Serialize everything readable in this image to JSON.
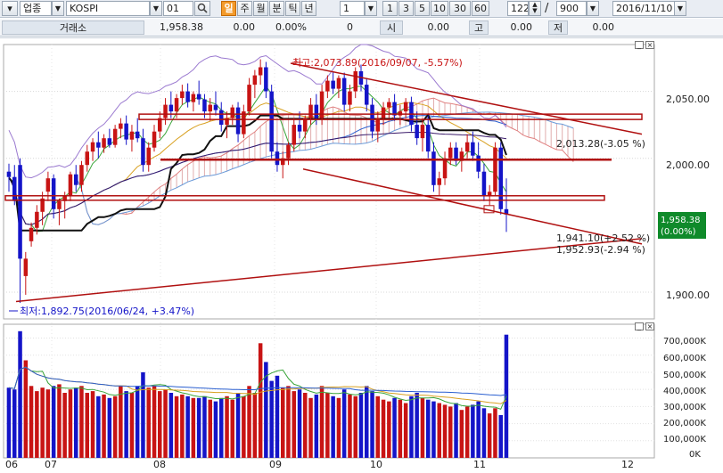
{
  "toolbar": {
    "market": "업종",
    "index": "KOSPI",
    "code": "01",
    "periods": [
      "일",
      "주",
      "월",
      "분",
      "틱",
      "년"
    ],
    "interval": "1",
    "minutes": [
      "1",
      "3",
      "5",
      "10",
      "30",
      "60"
    ],
    "count": "122",
    "total": "900",
    "date": "2016/11/10"
  },
  "info": {
    "label": "거래소",
    "price": "1,958.38",
    "change": "0.00",
    "rate": "0.00%",
    "volume": "0",
    "open_label": "시",
    "open": "0.00",
    "high_label": "고",
    "high": "0.00",
    "low_label": "저",
    "low": "0.00"
  },
  "price_axis": [
    "2,050.00",
    "2,000.00",
    "1,900.00"
  ],
  "volume_axis": [
    "700,000K",
    "600,000K",
    "500,000K",
    "400,000K",
    "300,000K",
    "200,000K",
    "100,000K",
    "0K"
  ],
  "months": [
    "06",
    "07",
    "08",
    "09",
    "10",
    "11",
    "12"
  ],
  "annotations": {
    "high": "최고:2,073.89(2016/09/07, -5.57%)",
    "low": "최저:1,892.75(2016/06/24, +3.47%)",
    "line1": "2,013.28(-3.05 %)",
    "line2": "1,941.10(+2.52 %)",
    "line3": "1,952.93(-2.94 %)"
  },
  "current_price": "1,958.38",
  "current_rate": "(0.00%)",
  "colors": {
    "up": "#c81414",
    "down": "#1414c8",
    "line": "#b01010",
    "ichimoku_cloud": "#d99a9a"
  },
  "chart_data": {
    "type": "candlestick",
    "ylim": [
      1880,
      2085
    ],
    "volume_ylim": [
      0,
      760
    ],
    "volume_unit": "K",
    "dates_range": [
      "2016/06",
      "2016/11/10"
    ],
    "months": [
      "06",
      "07",
      "08",
      "09",
      "10",
      "11",
      "12"
    ],
    "candles": [
      {
        "o": 1990,
        "h": 1996,
        "l": 1975,
        "c": 1986,
        "v": 410
      },
      {
        "o": 1986,
        "h": 1995,
        "l": 1965,
        "c": 1968,
        "v": 400
      },
      {
        "o": 1995,
        "h": 2000,
        "l": 1892,
        "c": 1925,
        "v": 740
      },
      {
        "o": 1912,
        "h": 1930,
        "l": 1898,
        "c": 1925,
        "v": 570
      },
      {
        "o": 1938,
        "h": 1952,
        "l": 1934,
        "c": 1948,
        "v": 420
      },
      {
        "o": 1948,
        "h": 1965,
        "l": 1943,
        "c": 1960,
        "v": 390
      },
      {
        "o": 1960,
        "h": 1975,
        "l": 1950,
        "c": 1970,
        "v": 410
      },
      {
        "o": 1975,
        "h": 1990,
        "l": 1968,
        "c": 1985,
        "v": 400
      },
      {
        "o": 1985,
        "h": 1988,
        "l": 1955,
        "c": 1962,
        "v": 420
      },
      {
        "o": 1962,
        "h": 1970,
        "l": 1950,
        "c": 1968,
        "v": 430
      },
      {
        "o": 1968,
        "h": 1975,
        "l": 1955,
        "c": 1972,
        "v": 380
      },
      {
        "o": 1972,
        "h": 1990,
        "l": 1968,
        "c": 1988,
        "v": 400
      },
      {
        "o": 1988,
        "h": 1995,
        "l": 1975,
        "c": 1980,
        "v": 410
      },
      {
        "o": 1980,
        "h": 1998,
        "l": 1975,
        "c": 1995,
        "v": 420
      },
      {
        "o": 1995,
        "h": 2010,
        "l": 1990,
        "c": 2005,
        "v": 380
      },
      {
        "o": 2005,
        "h": 2015,
        "l": 1998,
        "c": 2012,
        "v": 390
      },
      {
        "o": 2012,
        "h": 2020,
        "l": 2000,
        "c": 2008,
        "v": 360
      },
      {
        "o": 2008,
        "h": 2018,
        "l": 2004,
        "c": 2015,
        "v": 370
      },
      {
        "o": 2015,
        "h": 2022,
        "l": 2008,
        "c": 2010,
        "v": 350
      },
      {
        "o": 2010,
        "h": 2025,
        "l": 2008,
        "c": 2022,
        "v": 360
      },
      {
        "o": 2022,
        "h": 2030,
        "l": 2015,
        "c": 2026,
        "v": 420
      },
      {
        "o": 2026,
        "h": 2032,
        "l": 2010,
        "c": 2014,
        "v": 390
      },
      {
        "o": 2014,
        "h": 2025,
        "l": 2005,
        "c": 2020,
        "v": 380
      },
      {
        "o": 2020,
        "h": 2030,
        "l": 2012,
        "c": 2015,
        "v": 420
      },
      {
        "o": 2015,
        "h": 2022,
        "l": 1990,
        "c": 1995,
        "v": 500
      },
      {
        "o": 1995,
        "h": 2012,
        "l": 1990,
        "c": 2008,
        "v": 410
      },
      {
        "o": 2008,
        "h": 2025,
        "l": 2005,
        "c": 2020,
        "v": 420
      },
      {
        "o": 2020,
        "h": 2035,
        "l": 2015,
        "c": 2030,
        "v": 390
      },
      {
        "o": 2030,
        "h": 2045,
        "l": 2025,
        "c": 2040,
        "v": 400
      },
      {
        "o": 2040,
        "h": 2050,
        "l": 2030,
        "c": 2035,
        "v": 380
      },
      {
        "o": 2035,
        "h": 2048,
        "l": 2030,
        "c": 2045,
        "v": 360
      },
      {
        "o": 2045,
        "h": 2055,
        "l": 2040,
        "c": 2050,
        "v": 370
      },
      {
        "o": 2050,
        "h": 2056,
        "l": 2038,
        "c": 2042,
        "v": 360
      },
      {
        "o": 2042,
        "h": 2050,
        "l": 2035,
        "c": 2048,
        "v": 350
      },
      {
        "o": 2048,
        "h": 2058,
        "l": 2040,
        "c": 2044,
        "v": 350
      },
      {
        "o": 2044,
        "h": 2048,
        "l": 2030,
        "c": 2035,
        "v": 360
      },
      {
        "o": 2035,
        "h": 2045,
        "l": 2028,
        "c": 2040,
        "v": 340
      },
      {
        "o": 2040,
        "h": 2050,
        "l": 2032,
        "c": 2036,
        "v": 330
      },
      {
        "o": 2036,
        "h": 2042,
        "l": 2020,
        "c": 2025,
        "v": 350
      },
      {
        "o": 2025,
        "h": 2035,
        "l": 2015,
        "c": 2030,
        "v": 360
      },
      {
        "o": 2030,
        "h": 2040,
        "l": 2025,
        "c": 2038,
        "v": 340
      },
      {
        "o": 2038,
        "h": 2042,
        "l": 2012,
        "c": 2018,
        "v": 380
      },
      {
        "o": 2018,
        "h": 2040,
        "l": 2015,
        "c": 2035,
        "v": 360
      },
      {
        "o": 2035,
        "h": 2060,
        "l": 2032,
        "c": 2055,
        "v": 420
      },
      {
        "o": 2055,
        "h": 2066,
        "l": 2045,
        "c": 2062,
        "v": 380
      },
      {
        "o": 2062,
        "h": 2074,
        "l": 2055,
        "c": 2068,
        "v": 670
      },
      {
        "o": 2068,
        "h": 2072,
        "l": 2045,
        "c": 2050,
        "v": 560
      },
      {
        "o": 2050,
        "h": 2055,
        "l": 2000,
        "c": 2005,
        "v": 450
      },
      {
        "o": 2005,
        "h": 2012,
        "l": 1990,
        "c": 1995,
        "v": 480
      },
      {
        "o": 1995,
        "h": 2005,
        "l": 1985,
        "c": 2000,
        "v": 410
      },
      {
        "o": 2000,
        "h": 2012,
        "l": 1995,
        "c": 2010,
        "v": 420
      },
      {
        "o": 2010,
        "h": 2030,
        "l": 2005,
        "c": 2025,
        "v": 390
      },
      {
        "o": 2025,
        "h": 2035,
        "l": 2015,
        "c": 2020,
        "v": 400
      },
      {
        "o": 2020,
        "h": 2032,
        "l": 2015,
        "c": 2030,
        "v": 380
      },
      {
        "o": 2030,
        "h": 2045,
        "l": 2025,
        "c": 2040,
        "v": 350
      },
      {
        "o": 2040,
        "h": 2048,
        "l": 2025,
        "c": 2030,
        "v": 370
      },
      {
        "o": 2030,
        "h": 2055,
        "l": 2025,
        "c": 2050,
        "v": 420
      },
      {
        "o": 2050,
        "h": 2062,
        "l": 2045,
        "c": 2058,
        "v": 380
      },
      {
        "o": 2058,
        "h": 2065,
        "l": 2048,
        "c": 2052,
        "v": 360
      },
      {
        "o": 2052,
        "h": 2062,
        "l": 2045,
        "c": 2060,
        "v": 350
      },
      {
        "o": 2060,
        "h": 2064,
        "l": 2035,
        "c": 2040,
        "v": 400
      },
      {
        "o": 2040,
        "h": 2055,
        "l": 2035,
        "c": 2050,
        "v": 370
      },
      {
        "o": 2050,
        "h": 2068,
        "l": 2045,
        "c": 2065,
        "v": 360
      },
      {
        "o": 2065,
        "h": 2070,
        "l": 2050,
        "c": 2055,
        "v": 380
      },
      {
        "o": 2055,
        "h": 2060,
        "l": 2035,
        "c": 2040,
        "v": 420
      },
      {
        "o": 2040,
        "h": 2045,
        "l": 2015,
        "c": 2020,
        "v": 390
      },
      {
        "o": 2020,
        "h": 2035,
        "l": 2012,
        "c": 2030,
        "v": 360
      },
      {
        "o": 2030,
        "h": 2042,
        "l": 2025,
        "c": 2038,
        "v": 340
      },
      {
        "o": 2038,
        "h": 2045,
        "l": 2030,
        "c": 2042,
        "v": 330
      },
      {
        "o": 2042,
        "h": 2048,
        "l": 2028,
        "c": 2032,
        "v": 350
      },
      {
        "o": 2032,
        "h": 2040,
        "l": 2025,
        "c": 2035,
        "v": 340
      },
      {
        "o": 2035,
        "h": 2045,
        "l": 2030,
        "c": 2042,
        "v": 320
      },
      {
        "o": 2042,
        "h": 2046,
        "l": 2020,
        "c": 2025,
        "v": 360
      },
      {
        "o": 2025,
        "h": 2035,
        "l": 2010,
        "c": 2015,
        "v": 380
      },
      {
        "o": 2015,
        "h": 2030,
        "l": 2005,
        "c": 2025,
        "v": 350
      },
      {
        "o": 2025,
        "h": 2032,
        "l": 2000,
        "c": 2005,
        "v": 340
      },
      {
        "o": 2005,
        "h": 2012,
        "l": 1975,
        "c": 1980,
        "v": 330
      },
      {
        "o": 1980,
        "h": 1990,
        "l": 1972,
        "c": 1985,
        "v": 320
      },
      {
        "o": 1985,
        "h": 2005,
        "l": 1980,
        "c": 2000,
        "v": 310
      },
      {
        "o": 2000,
        "h": 2012,
        "l": 1995,
        "c": 2008,
        "v": 300
      },
      {
        "o": 2008,
        "h": 2012,
        "l": 1995,
        "c": 1998,
        "v": 320
      },
      {
        "o": 1998,
        "h": 2008,
        "l": 1990,
        "c": 2005,
        "v": 280
      },
      {
        "o": 2005,
        "h": 2018,
        "l": 2000,
        "c": 2012,
        "v": 300
      },
      {
        "o": 2012,
        "h": 2020,
        "l": 1998,
        "c": 2002,
        "v": 310
      },
      {
        "o": 2002,
        "h": 2012,
        "l": 1985,
        "c": 1990,
        "v": 330
      },
      {
        "o": 1990,
        "h": 1996,
        "l": 1968,
        "c": 1972,
        "v": 290
      },
      {
        "o": 1972,
        "h": 1980,
        "l": 1965,
        "c": 1975,
        "v": 260
      },
      {
        "o": 1975,
        "h": 2012,
        "l": 1972,
        "c": 2008,
        "v": 290
      },
      {
        "o": 2008,
        "h": 2012,
        "l": 1958,
        "c": 1962,
        "v": 250
      },
      {
        "o": 1962,
        "h": 1985,
        "l": 1945,
        "c": 1958,
        "v": 720
      }
    ]
  }
}
